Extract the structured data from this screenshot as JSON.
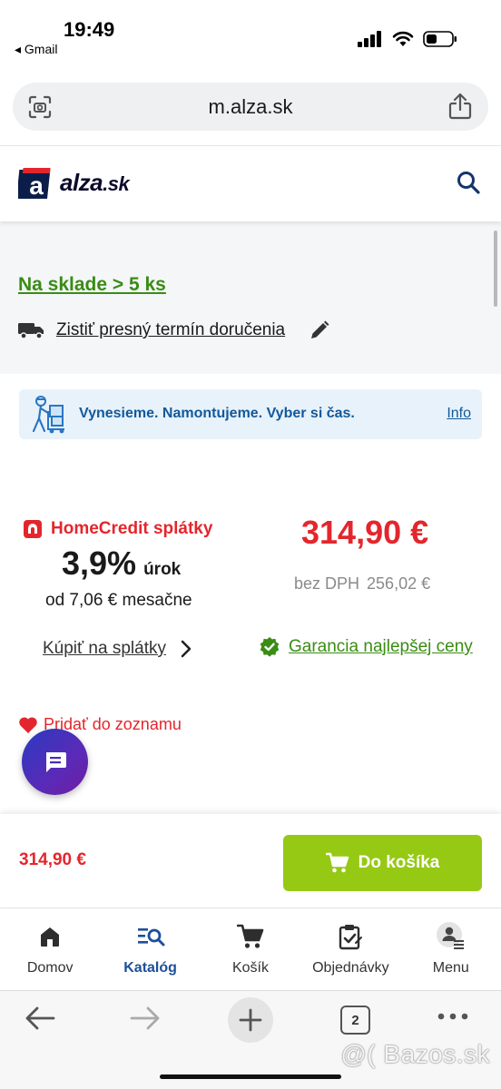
{
  "status_bar": {
    "time": "19:49",
    "back_app": "◂ Gmail",
    "battery_level": 0.35
  },
  "url_bar": {
    "url": "m.alza.sk",
    "left_icon": "page-scan-icon",
    "right_icon": "share-icon"
  },
  "header": {
    "logo_text": "alza",
    "logo_suffix": ".sk",
    "search_icon": "search-icon"
  },
  "stock": {
    "availability": "Na sklade > 5 ks",
    "delivery_link": "Zistiť presný termín doručenia"
  },
  "info_banner": {
    "text": "Vynesieme. Namontujeme. Vyber si čas.",
    "link": "Info"
  },
  "home_credit": {
    "title": "HomeCredit splátky",
    "rate": "3,9%",
    "rate_label": "úrok",
    "monthly": "od 7,06 € mesačne",
    "buy_link": "Kúpiť na splátky"
  },
  "price": {
    "main": "314,90 €",
    "vat_label": "bez DPH",
    "vat_value": "256,02 €",
    "guarantee": "Garancia najlepšej ceny"
  },
  "wishlist": {
    "label": "Pridať do zoznamu"
  },
  "cart_bar": {
    "price": "314,90 €",
    "button": "Do košíka"
  },
  "bottom_nav": {
    "items": [
      {
        "label": "Domov",
        "icon": "home-icon"
      },
      {
        "label": "Katalóg",
        "icon": "catalog-icon",
        "active": true
      },
      {
        "label": "Košík",
        "icon": "cart-icon"
      },
      {
        "label": "Objednávky",
        "icon": "orders-icon"
      },
      {
        "label": "Menu",
        "icon": "menu-user-icon"
      }
    ]
  },
  "browser_bar": {
    "tab_count": "2"
  },
  "watermark": "@( Bazos.sk",
  "colors": {
    "accent_red": "#e3262d",
    "green": "#3a8c14",
    "cart_green": "#96c914",
    "blue": "#1d4f9a"
  }
}
